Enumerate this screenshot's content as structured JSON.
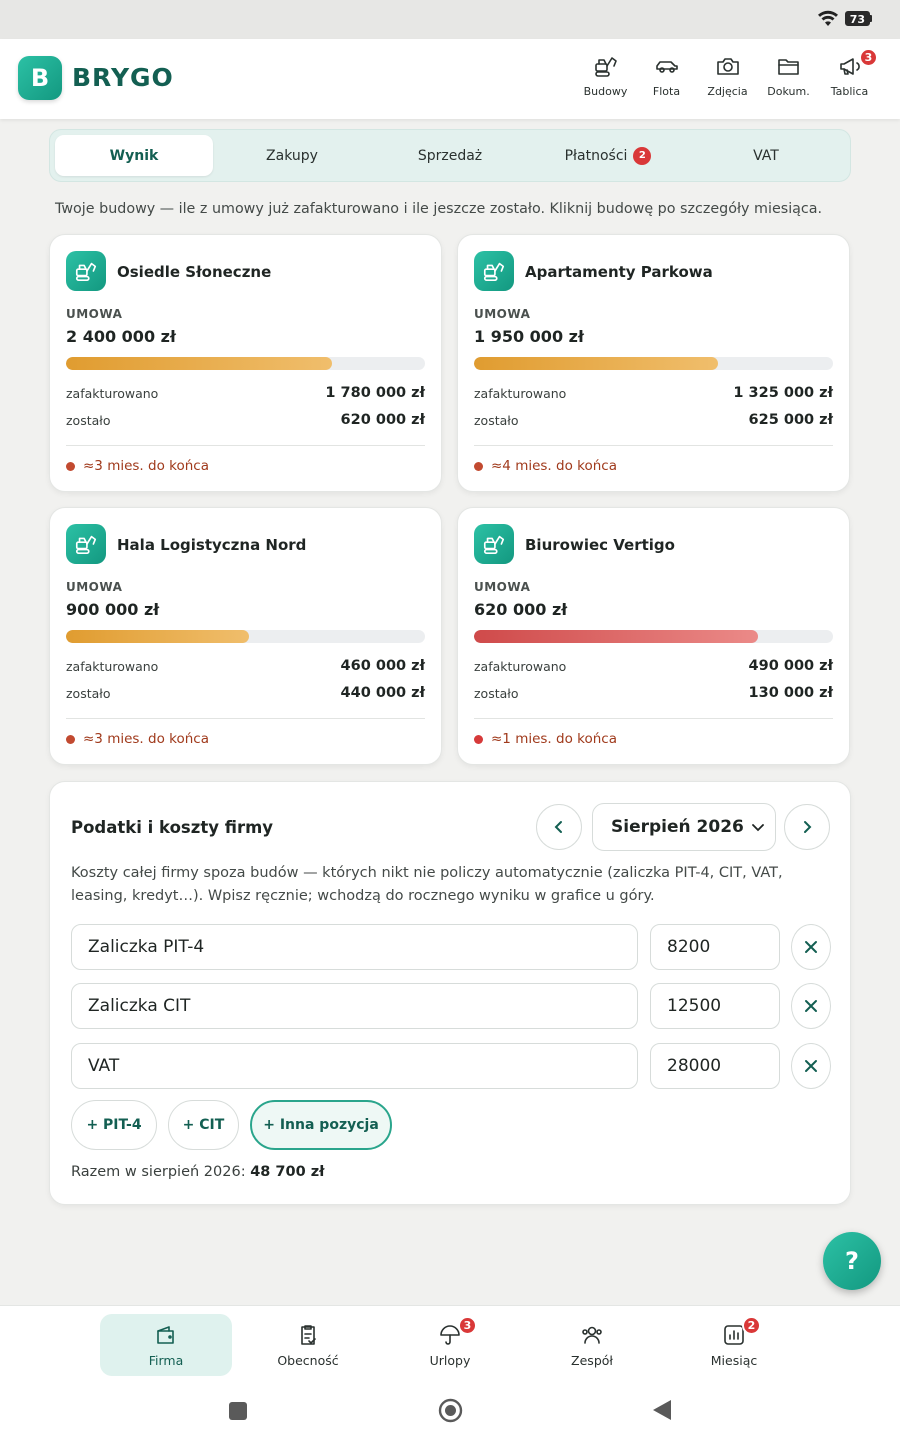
{
  "status_bar": {
    "battery": "73"
  },
  "app": {
    "logo_letter": "B",
    "brand": "BRYGO"
  },
  "top_nav": [
    {
      "label": "Budowy",
      "icon": "excavator-icon"
    },
    {
      "label": "Flota",
      "icon": "car-icon"
    },
    {
      "label": "Zdjęcia",
      "icon": "camera-icon"
    },
    {
      "label": "Dokum.",
      "icon": "folder-icon"
    },
    {
      "label": "Tablica",
      "icon": "megaphone-icon",
      "badge": "3"
    }
  ],
  "tabs": [
    {
      "label": "Wynik",
      "active": true
    },
    {
      "label": "Zakupy"
    },
    {
      "label": "Sprzedaż"
    },
    {
      "label": "Płatności",
      "badge": "2"
    },
    {
      "label": "VAT"
    }
  ],
  "intro": "Twoje budowy — ile z umowy już zafakturowano i ile jeszcze zostało. Kliknij budowę po szczegóły miesiąca.",
  "sites": [
    {
      "name": "Osiedle Słoneczne",
      "contract_label": "UMOWA",
      "contract": "2 400 000 zł",
      "invoiced_label": "zafakturowano",
      "invoiced": "1 780 000 zł",
      "remaining_label": "zostało",
      "remaining": "620 000 zł",
      "progress": 0.742,
      "status": "warning",
      "eta": "≈3 mies. do końca"
    },
    {
      "name": "Apartamenty Parkowa",
      "contract_label": "UMOWA",
      "contract": "1 950 000 zł",
      "invoiced_label": "zafakturowano",
      "invoiced": "1 325 000 zł",
      "remaining_label": "zostało",
      "remaining": "625 000 zł",
      "progress": 0.679,
      "status": "warning",
      "eta": "≈4 mies. do końca"
    },
    {
      "name": "Hala Logistyczna Nord",
      "contract_label": "UMOWA",
      "contract": "900 000 zł",
      "invoiced_label": "zafakturowano",
      "invoiced": "460 000 zł",
      "remaining_label": "zostało",
      "remaining": "440 000 zł",
      "progress": 0.511,
      "status": "warning",
      "eta": "≈3 mies. do końca"
    },
    {
      "name": "Biurowiec Vertigo",
      "contract_label": "UMOWA",
      "contract": "620 000 zł",
      "invoiced_label": "zafakturowano",
      "invoiced": "490 000 zł",
      "remaining_label": "zostało",
      "remaining": "130 000 zł",
      "progress": 0.79,
      "status": "danger",
      "eta": "≈1 mies. do końca"
    }
  ],
  "costs": {
    "title": "Podatki i koszty firmy",
    "month": "Sierpień 2026",
    "description": "Koszty całej firmy spoza budów — których nikt nie policzy automatycznie (zaliczka PIT-4, CIT, VAT, leasing, kredyt…). Wpisz ręcznie; wchodzą do rocznego wyniku w grafice u góry.",
    "items": [
      {
        "name": "Zaliczka PIT-4",
        "amount": "8200"
      },
      {
        "name": "Zaliczka CIT",
        "amount": "12500"
      },
      {
        "name": "VAT",
        "amount": "28000"
      }
    ],
    "add_buttons": [
      "+ PIT-4",
      "+ CIT",
      "+ Inna pozycja"
    ],
    "total_label": "Razem w sierpień 2026:",
    "total_value": "48 700 zł"
  },
  "help": "?",
  "bottom_nav": [
    {
      "label": "Firma",
      "icon": "wallet-icon",
      "active": true
    },
    {
      "label": "Obecność",
      "icon": "clipboard-check-icon"
    },
    {
      "label": "Urlopy",
      "icon": "umbrella-icon",
      "badge": "3"
    },
    {
      "label": "Zespół",
      "icon": "team-icon"
    },
    {
      "label": "Miesiąc",
      "icon": "bar-chart-icon",
      "badge": "2"
    }
  ],
  "colors": {
    "brand": "#139880",
    "brand_dark": "#135f52",
    "warning": "#e09c30",
    "danger": "#cf4a4a",
    "badge": "#d93838"
  }
}
